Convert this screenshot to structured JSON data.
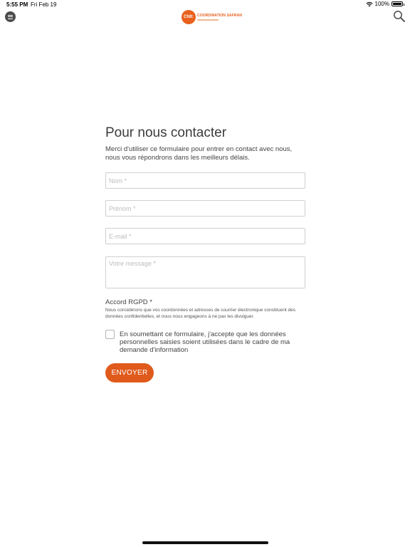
{
  "status_bar": {
    "time": "5:55 PM",
    "date": "Fri Feb 19",
    "battery": "100%",
    "battery_level": 1.0
  },
  "header": {
    "menu_icon": "hamburger-menu-icon",
    "logo": {
      "badge_text": "Cfdt:",
      "title": "COORDINATION SAFRAN"
    },
    "search_icon": "search-icon"
  },
  "contact": {
    "title": "Pour nous contacter",
    "intro_line1": "Merci d'utiliser ce formulaire pour entrer en contact avec nous,",
    "intro_line2": "nous vous répondrons dans les meilleurs délais.",
    "fields": {
      "nom": {
        "placeholder": "Nom *",
        "value": ""
      },
      "prenom": {
        "placeholder": "Prénom *",
        "value": ""
      },
      "email": {
        "placeholder": "E-mail *",
        "value": ""
      },
      "message": {
        "placeholder": "Votre message *",
        "value": ""
      }
    },
    "consent": {
      "heading": "Accord RGPD *",
      "note": "Nous considérons que vos coordonnées et adresses de courrier électronique constituent des données confidentielles, et nous nous engageons à ne pas les divulguer.",
      "checkbox_label": "En soumettant ce formulaire, j'accepte que les données personnelles saisies soient utilisées dans le cadre de ma demande d'information",
      "checked": false
    },
    "submit_label": "ENVOYER"
  },
  "colors": {
    "accent": "#e05a1c",
    "text": "#3b3b3b",
    "border": "#cfcfcf"
  }
}
